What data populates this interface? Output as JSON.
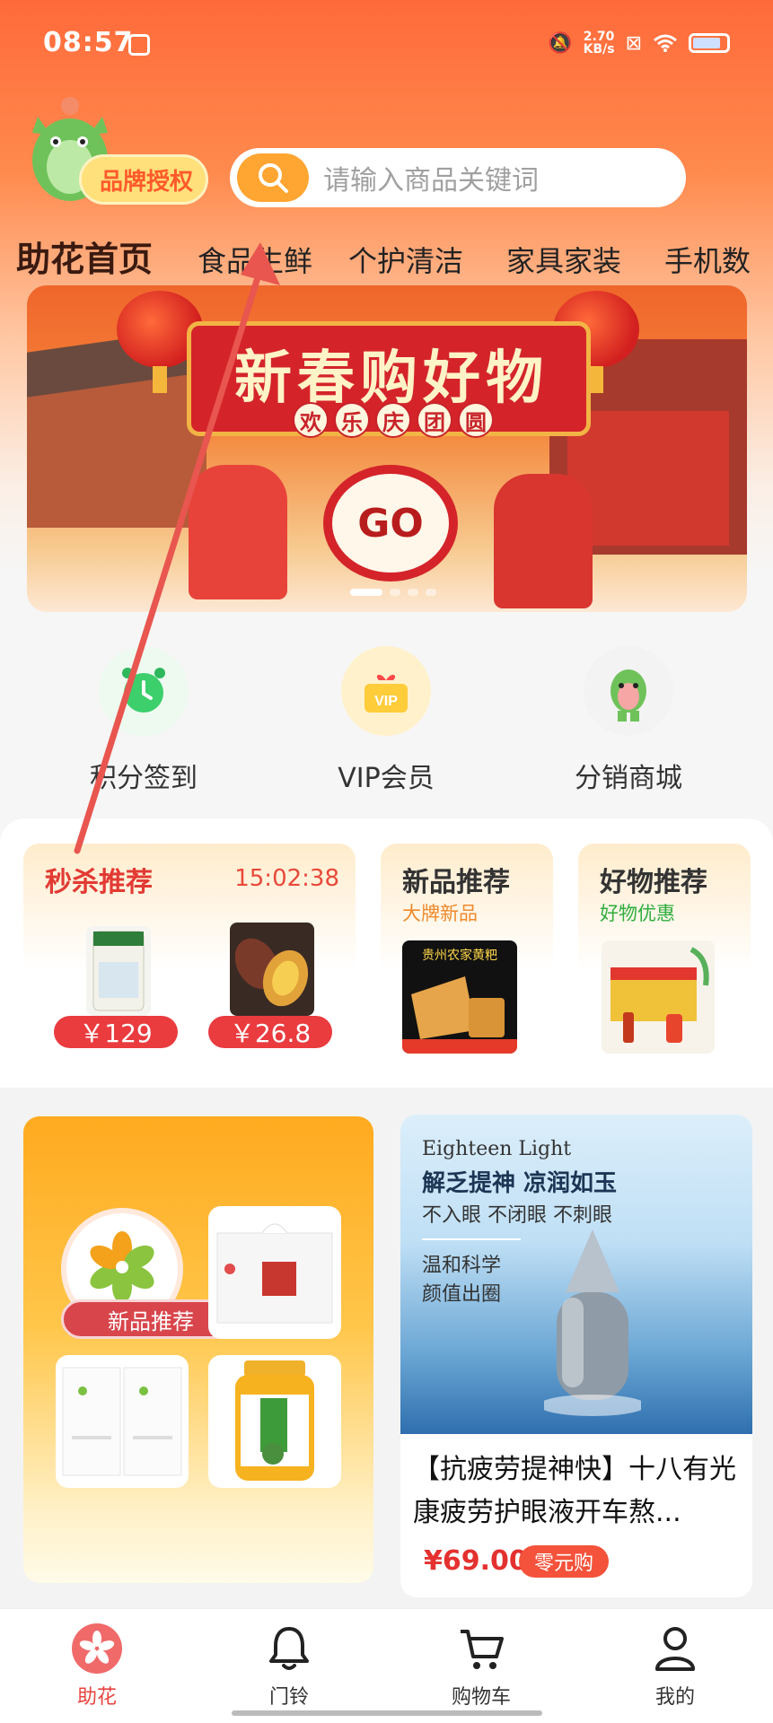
{
  "status_bar": {
    "time": "08:57",
    "net_speed_value": "2.70",
    "net_speed_unit": "KB/s"
  },
  "header": {
    "brand_badge": "品牌授权",
    "search_placeholder": "请输入商品关键词"
  },
  "category_tabs": {
    "home": "助花首页",
    "items": [
      "食品生鲜",
      "个护清洁",
      "家具家装",
      "手机数"
    ]
  },
  "banner": {
    "headline": "新春购好物",
    "subtitle_chars": [
      "欢",
      "乐",
      "庆",
      "团",
      "圆"
    ],
    "button": "GO"
  },
  "quick_actions": [
    {
      "label": "积分签到",
      "icon": "alarm-clock-icon"
    },
    {
      "label": "VIP会员",
      "icon": "vip-gift-icon"
    },
    {
      "label": "分销商城",
      "icon": "mascot-icon"
    }
  ],
  "promo": {
    "flash_sale": {
      "title": "秒杀推荐",
      "countdown": "15:02:38",
      "items": [
        {
          "price": "￥129",
          "image": "rice-bag"
        },
        {
          "price": "￥26.8",
          "image": "sweet-potato"
        }
      ]
    },
    "new_products": {
      "title": "新品推荐",
      "subtitle": "大牌新品",
      "image_text": "贵州农家黄粑"
    },
    "good_products": {
      "title": "好物推荐",
      "subtitle": "好物优惠"
    }
  },
  "feature_left": {
    "badge": "新品推荐"
  },
  "feature_right": {
    "brand": "Eighteen Light",
    "headline": "解乏提神 凉润如玉",
    "sub": "不入眼 不闭眼 不刺眼",
    "desc1": "温和科学",
    "desc2": "颜值出圈",
    "title": "【抗疲劳提神快】十八有光康疲劳护眼液开车熬...",
    "price": "¥69.00",
    "tag": "零元购"
  },
  "tab_bar": [
    {
      "label": "助花",
      "icon": "flower-icon",
      "active": true
    },
    {
      "label": "门铃",
      "icon": "bell-icon",
      "active": false
    },
    {
      "label": "购物车",
      "icon": "cart-icon",
      "active": false
    },
    {
      "label": "我的",
      "icon": "user-icon",
      "active": false
    }
  ],
  "colors": {
    "accent": "#ff6a3a",
    "price_red": "#e4312f",
    "search_button": "#ffa531",
    "annotation_arrow": "#e8564f"
  }
}
